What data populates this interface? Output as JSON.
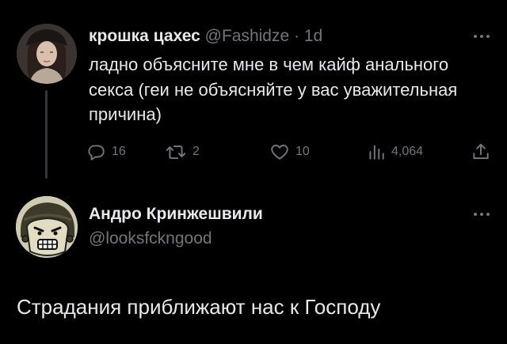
{
  "tweet": {
    "author_name": "крошка цахес",
    "author_handle": "@Fashidze",
    "separator": "·",
    "time": "1d",
    "text": "ладно объясните мне в чем кайф анального секса (геи не объясняйте у вас уважительная причина)",
    "stats": {
      "replies": "16",
      "retweets": "2",
      "likes": "10",
      "views": "4,064"
    },
    "icons": {
      "more": "more-icon",
      "reply": "reply-icon",
      "retweet": "retweet-icon",
      "like": "heart-icon",
      "views": "views-icon",
      "share": "share-icon"
    }
  },
  "reply": {
    "author_name": "Андро Кринжешвили",
    "author_handle": "@looksfckngood",
    "text": "Страдания приближают нас к Господу"
  },
  "colors": {
    "background": "#000000",
    "primary_text": "#e7e9ea",
    "secondary_text": "#71767b",
    "thread_line": "#333639"
  }
}
